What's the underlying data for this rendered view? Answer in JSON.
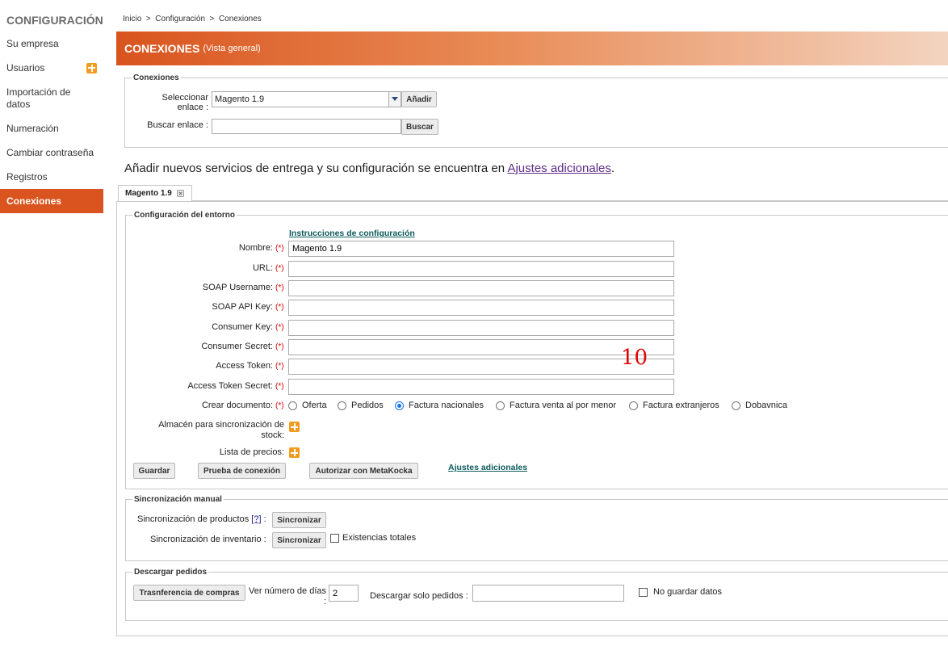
{
  "sidebar": {
    "title": "CONFIGURACIÓN",
    "items": [
      {
        "label": "Su empresa"
      },
      {
        "label": "Usuarios"
      },
      {
        "label": "Importación de datos"
      },
      {
        "label": "Numeración"
      },
      {
        "label": "Cambiar contraseña"
      },
      {
        "label": "Registros"
      },
      {
        "label": "Conexiones"
      }
    ]
  },
  "breadcrumb": "Inicio  >  Configuración  >  Conexiones",
  "header": {
    "title": "CONEXIONES",
    "subtitle": "(Vista general)"
  },
  "connections": {
    "legend": "Conexiones",
    "select_label": "Seleccionar enlace :",
    "select_value": "Magento 1.9",
    "add_button": "Añadir",
    "search_label": "Buscar enlace :",
    "search_button": "Buscar"
  },
  "note": {
    "text": "Añadir nuevos servicios de entrega y su configuración se encuentra en ",
    "link": "Ajustes adicionales",
    "end": "."
  },
  "tab": {
    "label": "Magento 1.9"
  },
  "env": {
    "legend": "Configuración del entorno",
    "instructions_link": "Instrucciones de configuración",
    "required_mark": "(*)",
    "fields": [
      {
        "label": "Nombre:",
        "value": "Magento 1.9"
      },
      {
        "label": "URL:",
        "value": ""
      },
      {
        "label": "SOAP Username:",
        "value": ""
      },
      {
        "label": "SOAP API Key:",
        "value": ""
      },
      {
        "label": "Consumer Key:",
        "value": ""
      },
      {
        "label": "Consumer Secret:",
        "value": ""
      },
      {
        "label": "Access Token:",
        "value": ""
      },
      {
        "label": "Access Token Secret:",
        "value": ""
      }
    ],
    "doc_label": "Crear documento:",
    "doc_options": [
      "Oferta",
      "Pedidos",
      "Factura nacionales",
      "Factura venta al por menor",
      "Factura extranjeros",
      "Dobavnica"
    ],
    "doc_selected": "Factura nacionales",
    "stock_label": "Almacén para sincronización de stock:",
    "price_label": "Lista de precios:",
    "save_button": "Guardar",
    "test_button": "Prueba de conexión",
    "authorize_button": "Autorizar con MetaKocka",
    "extra_link": "Ajustes adicionales"
  },
  "manual": {
    "legend": "Sincronización manual",
    "products_label": "Sincronización de productos",
    "help": "[?]",
    "products_suffix": ":",
    "sync_button": "Sincronizar",
    "inventory_label": "Sincronización de inventario :",
    "total_stock": "Existencias totales"
  },
  "download": {
    "legend": "Descargar pedidos",
    "transfer_button": "Trasnferencia de compras",
    "days_label": "Ver número de días :",
    "days_value": "2",
    "only_orders_label": "Descargar solo pedidos :",
    "only_orders_value": "",
    "no_save_label": "No guardar datos"
  },
  "overlay_number": "10"
}
